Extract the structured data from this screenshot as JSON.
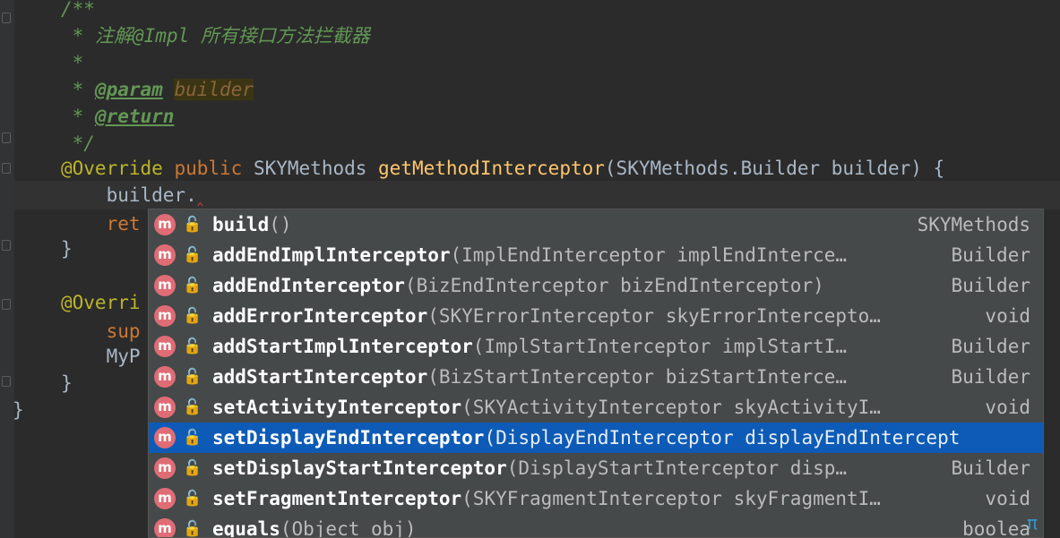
{
  "editor": {
    "lines": [
      {
        "parts": [
          [
            "doc",
            "/**"
          ]
        ]
      },
      {
        "parts": [
          [
            "doc",
            " * 注解@Impl 所有接口方法拦截器"
          ]
        ]
      },
      {
        "parts": [
          [
            "doc",
            " *"
          ]
        ]
      },
      {
        "parts": [
          [
            "doc",
            " * "
          ],
          [
            "doc-tag",
            "@param"
          ],
          [
            "doc",
            " "
          ],
          [
            "doc-param",
            "builder"
          ]
        ]
      },
      {
        "parts": [
          [
            "doc",
            " * "
          ],
          [
            "doc-tag",
            "@return"
          ]
        ]
      },
      {
        "parts": [
          [
            "doc",
            " */"
          ]
        ]
      },
      {
        "parts": [
          [
            "ann",
            "@Override"
          ],
          [
            "plain",
            " "
          ],
          [
            "kw",
            "public"
          ],
          [
            "plain",
            " SKYMethods "
          ],
          [
            "fn",
            "getMethodInterceptor"
          ],
          [
            "plain",
            "(SKYMethods.Builder builder) {"
          ]
        ]
      },
      {
        "parts": [
          [
            "plain",
            "    builder."
          ],
          [
            "err",
            "‸"
          ]
        ]
      },
      {
        "parts": [
          [
            "kw",
            "    ret"
          ]
        ]
      },
      {
        "parts": [
          [
            "plain",
            "}"
          ]
        ]
      },
      {
        "parts": [
          [
            "plain",
            ""
          ]
        ]
      },
      {
        "parts": [
          [
            "ann",
            "@Overri"
          ]
        ]
      },
      {
        "parts": [
          [
            "kw",
            "    sup"
          ]
        ]
      },
      {
        "parts": [
          [
            "plain",
            "    MyP"
          ]
        ]
      },
      {
        "parts": [
          [
            "plain",
            "}"
          ]
        ]
      },
      {
        "parts": [
          [
            "plain",
            "}"
          ]
        ]
      }
    ]
  },
  "completion": {
    "items": [
      {
        "name": "build",
        "params": "()",
        "ret": "SKYMethods"
      },
      {
        "name": "addEndImplInterceptor",
        "params": "(ImplEndInterceptor implEndInterce…",
        "ret": "Builder"
      },
      {
        "name": "addEndInterceptor",
        "params": "(BizEndInterceptor bizEndInterceptor)",
        "ret": "Builder"
      },
      {
        "name": "addErrorInterceptor",
        "params": "(SKYErrorInterceptor skyErrorIntercepto…",
        "ret": "void"
      },
      {
        "name": "addStartImplInterceptor",
        "params": "(ImplStartInterceptor implStartI…",
        "ret": "Builder"
      },
      {
        "name": "addStartInterceptor",
        "params": "(BizStartInterceptor bizStartInterce…",
        "ret": "Builder"
      },
      {
        "name": "setActivityInterceptor",
        "params": "(SKYActivityInterceptor skyActivityI…",
        "ret": "void"
      },
      {
        "name": "setDisplayEndInterceptor",
        "params": "(DisplayEndInterceptor displayEndIntercept",
        "ret": ""
      },
      {
        "name": "setDisplayStartInterceptor",
        "params": "(DisplayStartInterceptor disp…",
        "ret": "Builder"
      },
      {
        "name": "setFragmentInterceptor",
        "params": "(SKYFragmentInterceptor skyFragmentI…",
        "ret": "void"
      },
      {
        "name": "equals",
        "params": "(Object obj)",
        "ret": "boolea"
      }
    ],
    "selected_index": 7,
    "method_icon_letter": "m",
    "method_icon_name": "method-icon",
    "access_icon_name": "public-lock-icon",
    "access_icon_glyph": "🔓",
    "pi_glyph": "π"
  },
  "colors": {
    "background": "#2b2b2b",
    "popup": "#45494a",
    "selection": "#0d5bb6",
    "doc_comment": "#629755",
    "keyword": "#cc7832",
    "annotation": "#bbb529",
    "method_decl": "#ffc66d"
  }
}
